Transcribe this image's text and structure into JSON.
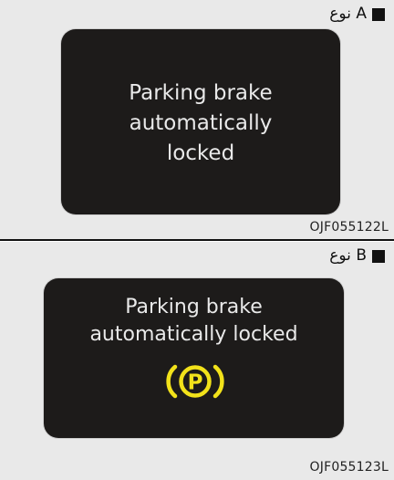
{
  "type_a": {
    "label": "نوع A",
    "message_line1": "Parking brake",
    "message_line2": "automatically",
    "message_line3": "locked",
    "code": "OJF055122L"
  },
  "type_b": {
    "label": "نوع B",
    "message_line1": "Parking brake",
    "message_line2": "automatically locked",
    "icon": "parking-brake-icon",
    "code": "OJF055123L"
  },
  "colors": {
    "panel_background": "#e9e9e9",
    "screen_background": "#1d1b1a",
    "screen_text": "#e9e9e9",
    "warning_icon": "#f2e21a",
    "label_square": "#111111"
  }
}
